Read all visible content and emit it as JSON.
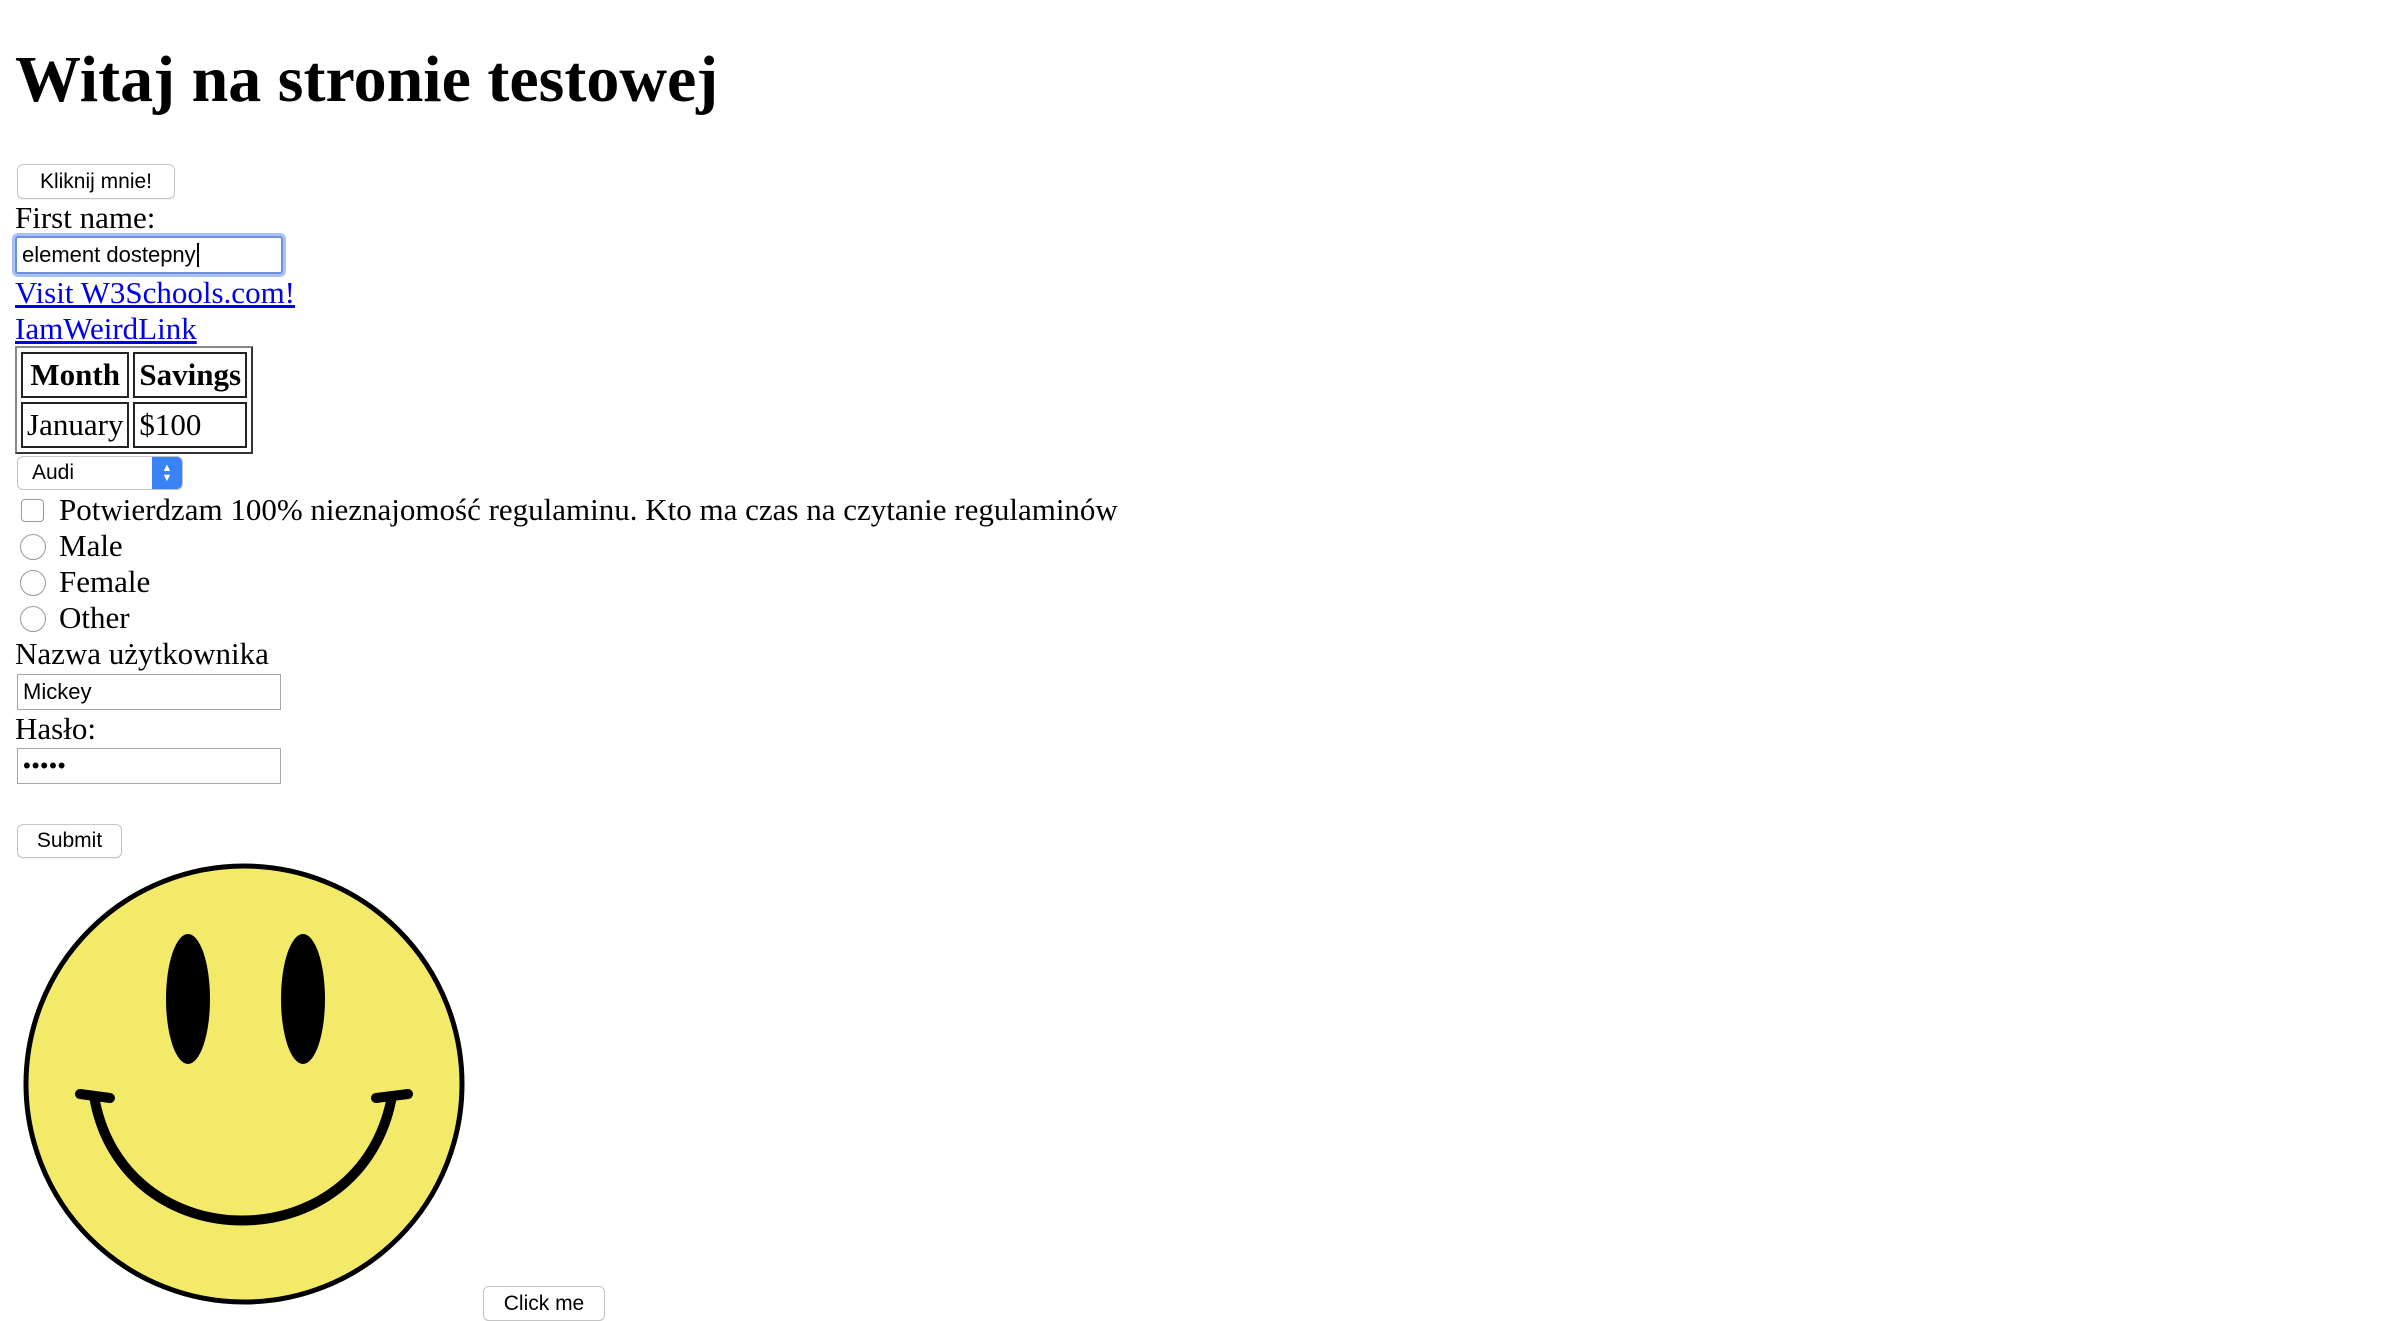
{
  "page": {
    "heading": "Witaj na stronie testowej",
    "click_button_label": "Kliknij mnie!",
    "first_name_label": "First name:",
    "first_name_value": "element dostepny",
    "link_w3schools": "Visit W3Schools.com!",
    "link_weird": "IamWeirdLink",
    "table": {
      "headers": [
        "Month",
        "Savings"
      ],
      "rows": [
        [
          "January",
          "$100"
        ]
      ]
    },
    "car_select_value": "Audi",
    "terms_checkbox_label": "Potwierdzam 100% nieznajomość regulaminu. Kto ma czas na czytanie regulaminów",
    "gender_options": [
      "Male",
      "Female",
      "Other"
    ],
    "username_label": "Nazwa użytkownika",
    "username_value": "Mickey",
    "password_label": "Hasło:",
    "password_value": "•••••",
    "submit_label": "Submit",
    "smiley_icon": "smiley-face-icon",
    "click_me_label": "Click me"
  },
  "colors": {
    "link": "#0000ee",
    "focus_ring": "#a9c1f6",
    "select_accent": "#3b82f6",
    "smiley_fill": "#f3ea6a"
  }
}
